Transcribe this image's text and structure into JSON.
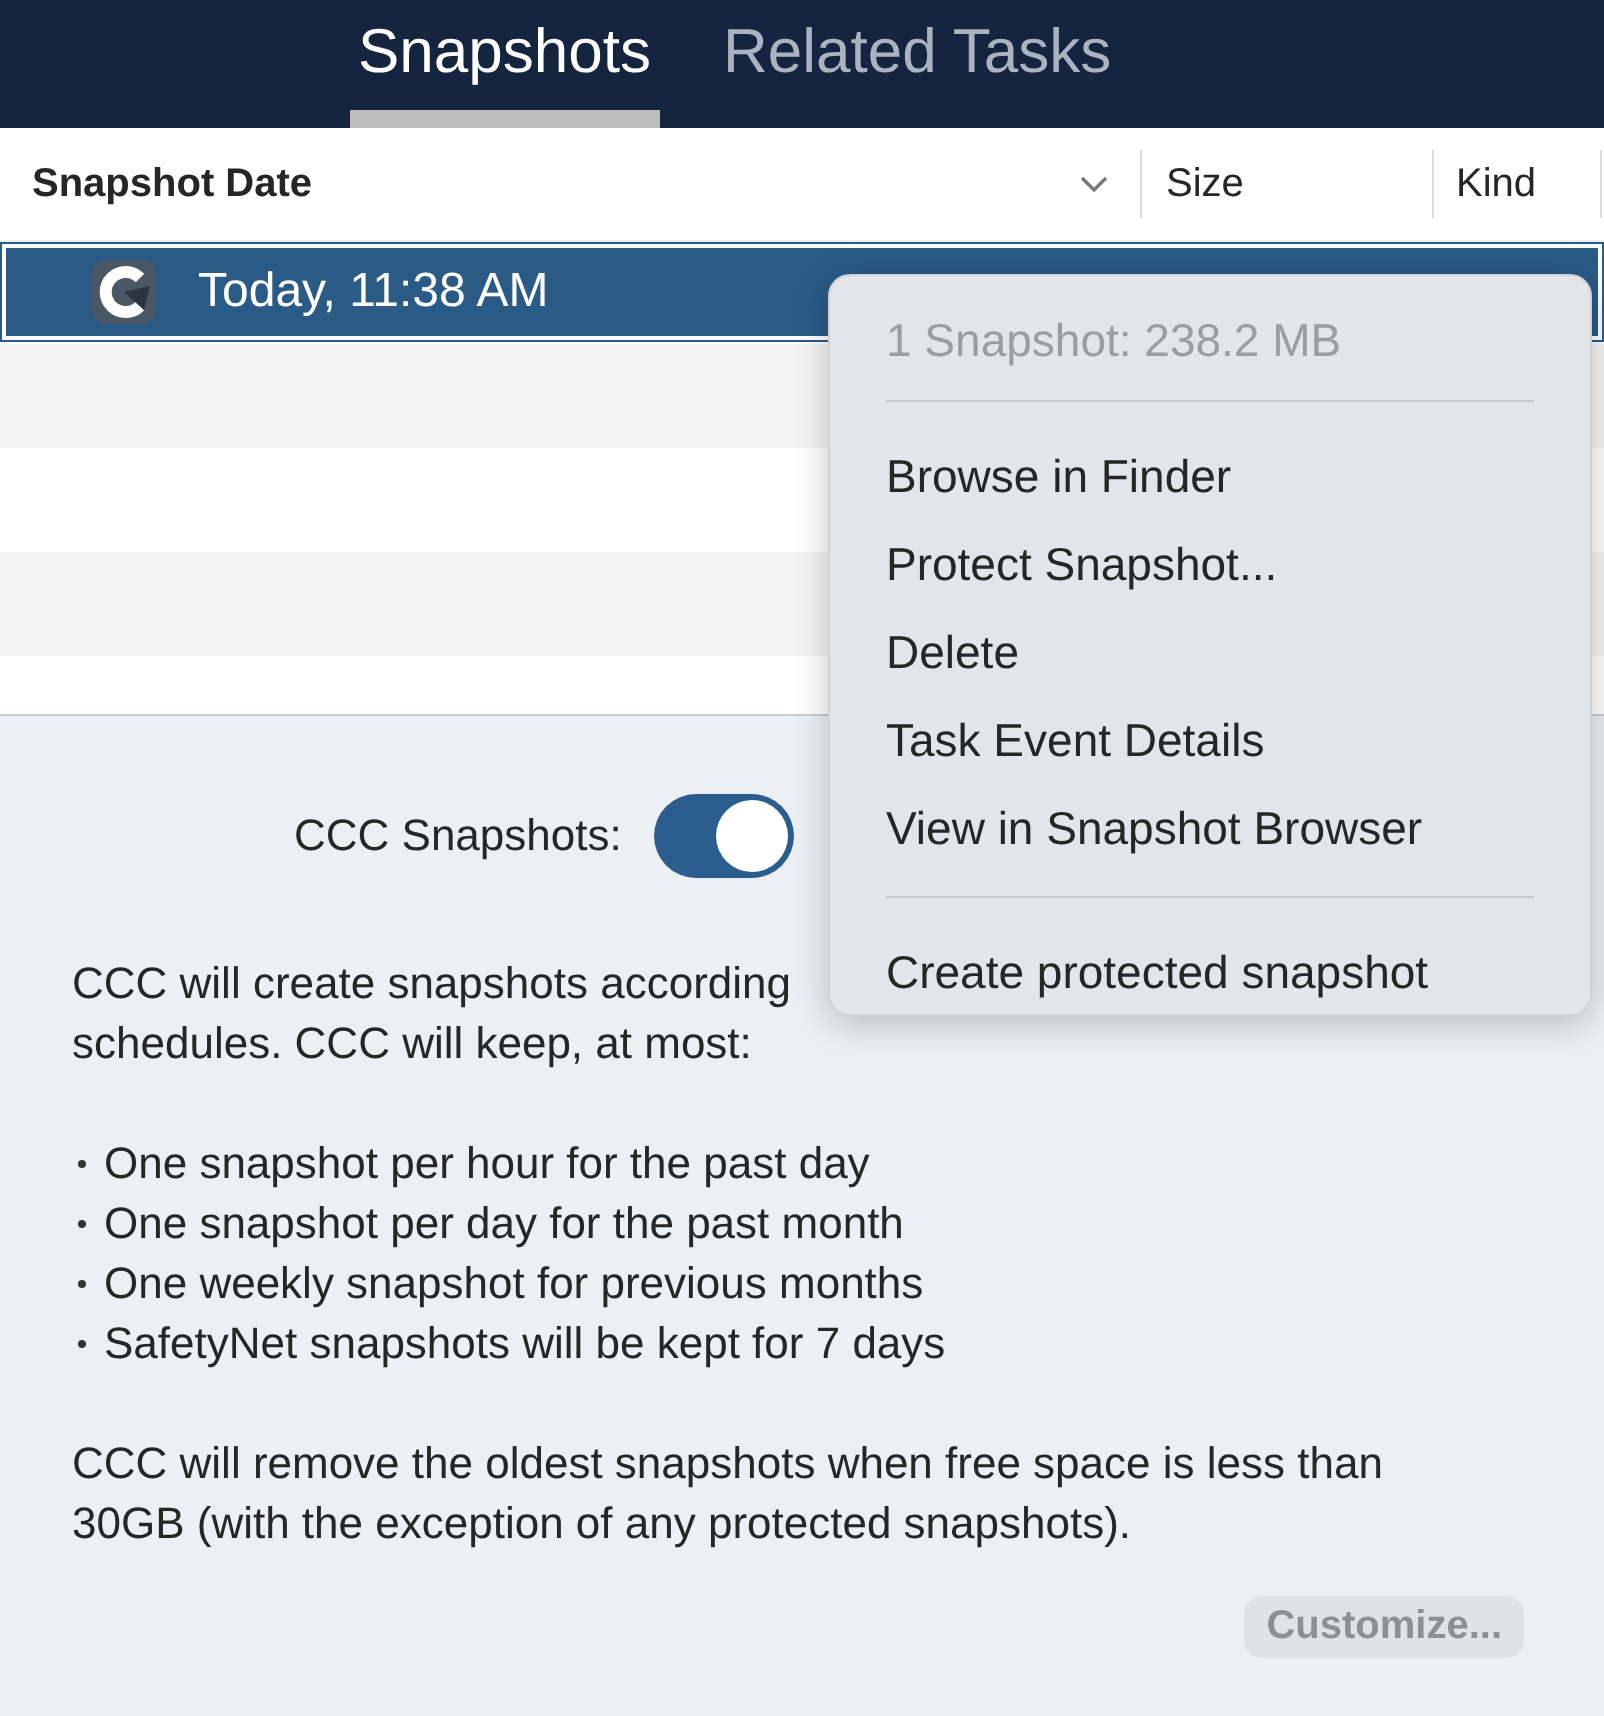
{
  "tabs": [
    {
      "label": "Snapshots",
      "selected": true
    },
    {
      "label": "Related Tasks",
      "selected": false
    }
  ],
  "table": {
    "columns": [
      {
        "label": "Snapshot Date",
        "sorted": true
      },
      {
        "label": "Size",
        "sorted": false
      },
      {
        "label": "Kind",
        "sorted": false
      }
    ],
    "rows": [
      {
        "date": "Today, 11:38 AM",
        "selected": true
      }
    ]
  },
  "snapshots_setting": {
    "label": "CCC Snapshots:",
    "on": true
  },
  "description_lines": [
    "CCC will create snapshots according",
    "schedules. CCC will keep, at most:"
  ],
  "retention_rules": [
    "One snapshot per hour for the past day",
    "One snapshot per day for the past month",
    "One weekly snapshot for previous months",
    "SafetyNet snapshots will be kept for 7 days"
  ],
  "footnote": "CCC will remove the oldest snapshots when free space is less than 30GB (with the exception of any protected snapshots).",
  "customize_button": {
    "label": "Customize...",
    "disabled": true
  },
  "context_menu": [
    {
      "kind": "header",
      "label": "1 Snapshot: 238.2 MB"
    },
    {
      "kind": "separator"
    },
    {
      "kind": "item",
      "label": "Browse in Finder"
    },
    {
      "kind": "item",
      "label": "Protect Snapshot..."
    },
    {
      "kind": "item",
      "label": "Delete"
    },
    {
      "kind": "item",
      "label": "Task Event Details"
    },
    {
      "kind": "item",
      "label": "View in Snapshot Browser"
    },
    {
      "kind": "separator"
    },
    {
      "kind": "item",
      "label": "Create protected snapshot"
    }
  ]
}
